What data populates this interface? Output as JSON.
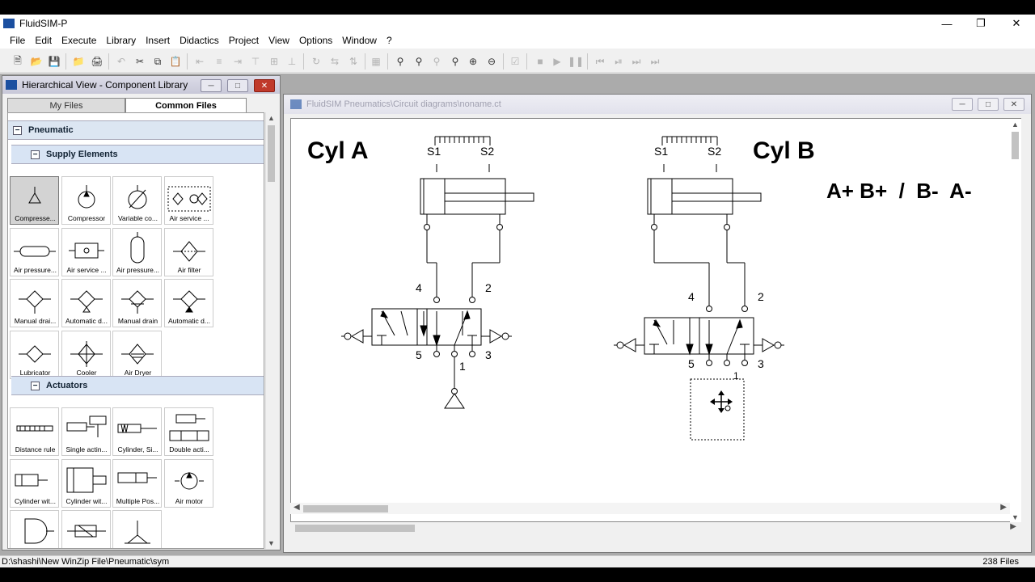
{
  "app": {
    "title": "FluidSIM-P"
  },
  "menu": [
    "File",
    "Edit",
    "Execute",
    "Library",
    "Insert",
    "Didactics",
    "Project",
    "View",
    "Options",
    "Window",
    "?"
  ],
  "library": {
    "title": "Hierarchical View - Component Library",
    "tabs": {
      "my_files": "My Files",
      "common_files": "Common Files"
    },
    "sections": {
      "pneumatic": "Pneumatic",
      "supply": "Supply Elements",
      "actuators": "Actuators"
    },
    "supply_items": [
      {
        "label": "Compresse...",
        "icon": "compressed-air-supply-icon"
      },
      {
        "label": "Compressor",
        "icon": "compressor-icon"
      },
      {
        "label": "Variable co...",
        "icon": "variable-compressor-icon"
      },
      {
        "label": "Air service ...",
        "icon": "air-service-unit-icon"
      },
      {
        "label": "Air pressure...",
        "icon": "air-pressure-reservoir-icon"
      },
      {
        "label": "Air service ...",
        "icon": "air-service-unit-simplified-icon"
      },
      {
        "label": "Air pressure...",
        "icon": "air-pressure-tank-icon"
      },
      {
        "label": "Air filter",
        "icon": "air-filter-icon"
      },
      {
        "label": "Manual drai...",
        "icon": "manual-drain-filter-icon"
      },
      {
        "label": "Automatic d...",
        "icon": "automatic-drain-filter-icon"
      },
      {
        "label": "Manual drain",
        "icon": "manual-drain-icon"
      },
      {
        "label": "Automatic d...",
        "icon": "automatic-drain-icon"
      },
      {
        "label": "Lubricator",
        "icon": "lubricator-icon"
      },
      {
        "label": "Cooler",
        "icon": "cooler-icon"
      },
      {
        "label": "Air Dryer",
        "icon": "air-dryer-icon"
      }
    ],
    "actuator_items": [
      {
        "label": "Distance rule",
        "icon": "distance-rule-icon"
      },
      {
        "label": "Single actin...",
        "icon": "single-acting-cylinder-icon"
      },
      {
        "label": "Cylinder, Si...",
        "icon": "cylinder-single-icon"
      },
      {
        "label": "Double acti...",
        "icon": "double-acting-cylinder-icon"
      },
      {
        "label": "Cylinder wit...",
        "icon": "cylinder-with-icon"
      },
      {
        "label": "Cylinder wit...",
        "icon": "cylinder-with-2-icon"
      },
      {
        "label": "Multiple Pos...",
        "icon": "multiple-position-cylinder-icon"
      },
      {
        "label": "Air motor",
        "icon": "air-motor-icon"
      },
      {
        "label": "",
        "icon": "semi-rotary-actuator-icon"
      },
      {
        "label": "",
        "icon": "linear-drive-icon"
      },
      {
        "label": "",
        "icon": "vacuum-suction-cup-icon"
      }
    ]
  },
  "circuit": {
    "title": "FluidSIM Pneumatics\\Circuit diagrams\\noname.ct",
    "cyl_a": "Cyl A",
    "cyl_b": "Cyl B",
    "sequence": "A+ B+  /  B-  A-",
    "s1": "S1",
    "s2": "S2",
    "port4": "4",
    "port2": "2",
    "port5": "5",
    "port3": "3",
    "port1": "1"
  },
  "status": {
    "path": "D:\\shashi\\New WinZip File\\Pneumatic\\sym",
    "count": "238 Files"
  }
}
